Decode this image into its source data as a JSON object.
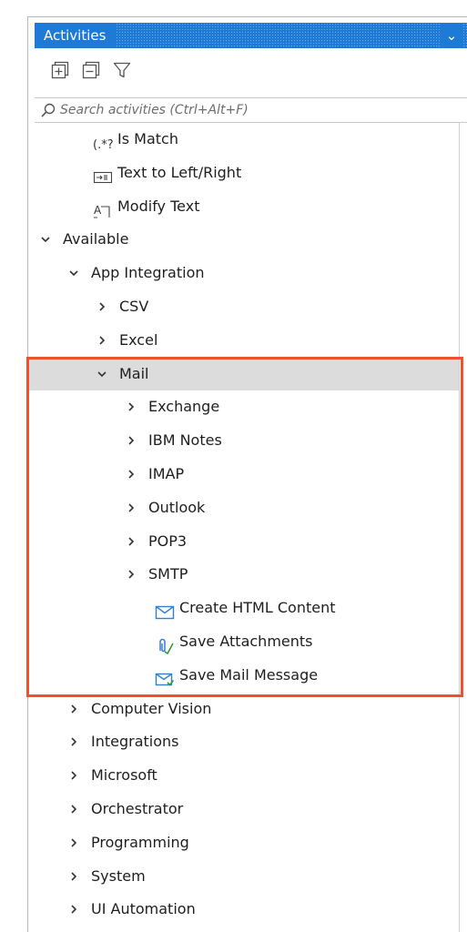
{
  "panel": {
    "title": "Activities",
    "dropdown_glyph": "⌄"
  },
  "toolbar": {
    "buttons": [
      {
        "name": "expand-all",
        "icon": "expand-all-icon"
      },
      {
        "name": "collapse-all",
        "icon": "collapse-all-icon"
      },
      {
        "name": "filter",
        "icon": "filter-icon"
      }
    ]
  },
  "search": {
    "placeholder": "Search activities (Ctrl+Alt+F)",
    "value": ""
  },
  "tree": {
    "rows": [
      {
        "label": "Is Match",
        "level": 2,
        "kind": "leaf",
        "icon": "regex-icon"
      },
      {
        "label": "Text to Left/Right",
        "level": 2,
        "kind": "leaf",
        "icon": "text-split-icon"
      },
      {
        "label": "Modify Text",
        "level": 2,
        "kind": "leaf",
        "icon": "modify-text-icon"
      },
      {
        "label": "Available",
        "level": 0,
        "kind": "expanded"
      },
      {
        "label": "App Integration",
        "level": 1,
        "kind": "expanded"
      },
      {
        "label": "CSV",
        "level": 2,
        "kind": "collapsed"
      },
      {
        "label": "Excel",
        "level": 2,
        "kind": "collapsed"
      },
      {
        "label": "Mail",
        "level": 2,
        "kind": "expanded",
        "selected": true
      },
      {
        "label": "Exchange",
        "level": 3,
        "kind": "collapsed"
      },
      {
        "label": "IBM Notes",
        "level": 3,
        "kind": "collapsed"
      },
      {
        "label": "IMAP",
        "level": 3,
        "kind": "collapsed"
      },
      {
        "label": "Outlook",
        "level": 3,
        "kind": "collapsed"
      },
      {
        "label": "POP3",
        "level": 3,
        "kind": "collapsed"
      },
      {
        "label": "SMTP",
        "level": 3,
        "kind": "collapsed"
      },
      {
        "label": "Create HTML Content",
        "level": 4,
        "kind": "leaf",
        "icon": "mail-envelope-icon"
      },
      {
        "label": "Save Attachments",
        "level": 4,
        "kind": "leaf",
        "icon": "paperclip-icon"
      },
      {
        "label": "Save Mail Message",
        "level": 4,
        "kind": "leaf",
        "icon": "mail-save-icon"
      },
      {
        "label": "Computer Vision",
        "level": 1,
        "kind": "collapsed"
      },
      {
        "label": "Integrations",
        "level": 1,
        "kind": "collapsed"
      },
      {
        "label": "Microsoft",
        "level": 1,
        "kind": "collapsed"
      },
      {
        "label": "Orchestrator",
        "level": 1,
        "kind": "collapsed"
      },
      {
        "label": "Programming",
        "level": 1,
        "kind": "collapsed"
      },
      {
        "label": "System",
        "level": 1,
        "kind": "collapsed"
      },
      {
        "label": "UI Automation",
        "level": 1,
        "kind": "collapsed"
      }
    ]
  },
  "colors": {
    "titlebar": "#1e7ad4",
    "highlight": "#f0502c",
    "selected_row": "#dcdcdc",
    "icon_blue": "#2f7fd6"
  }
}
